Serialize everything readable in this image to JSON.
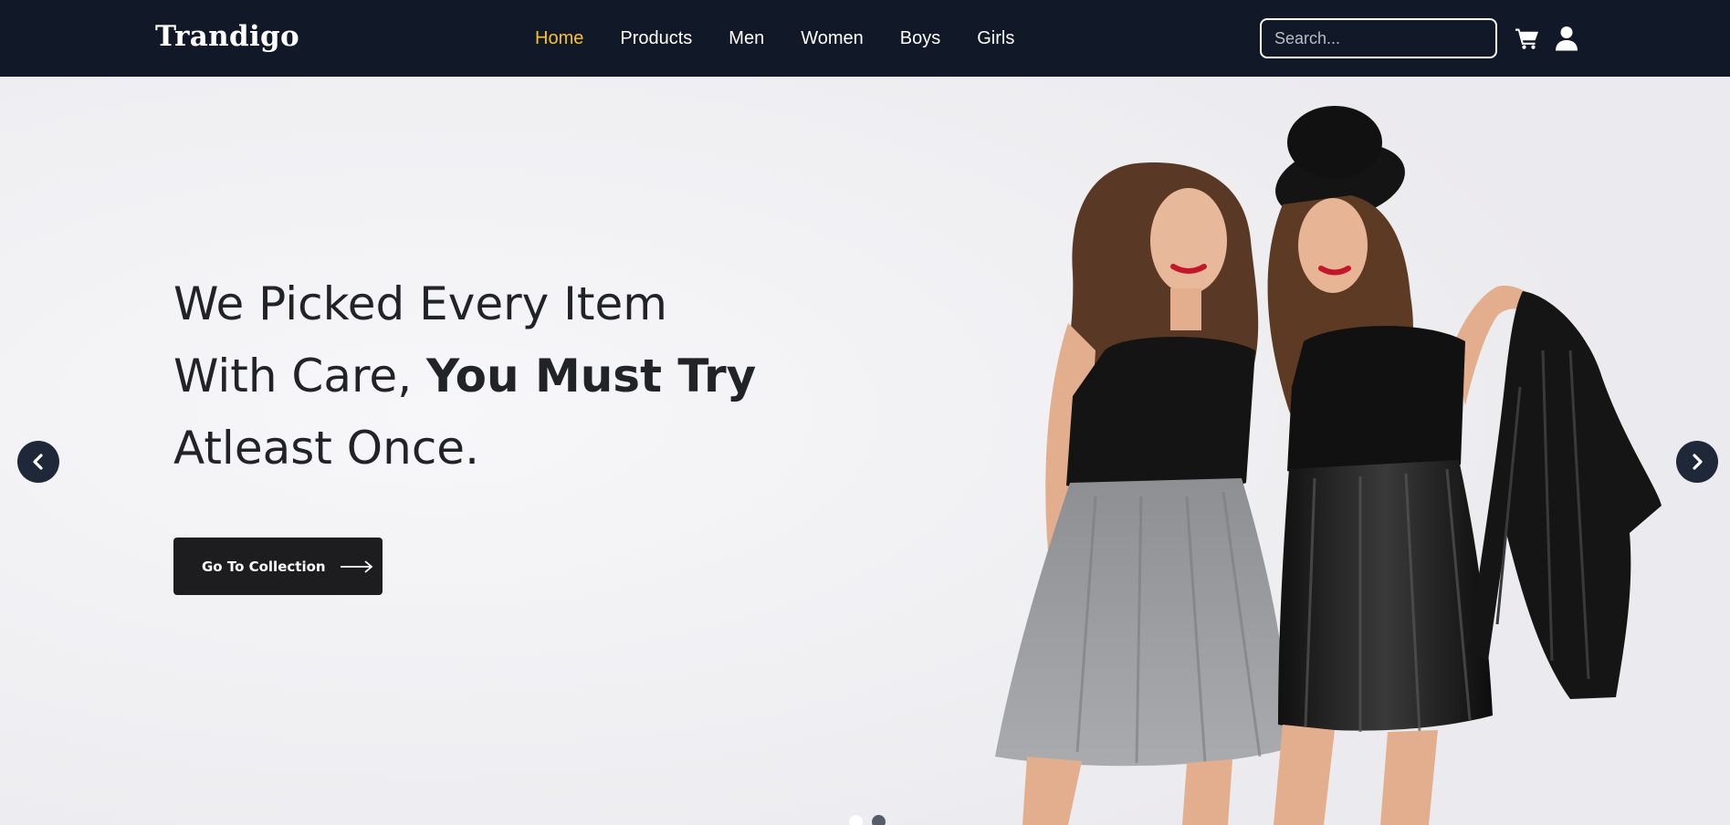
{
  "navbar": {
    "brand": "Trandigo",
    "links": [
      {
        "label": "Home",
        "active": true
      },
      {
        "label": "Products"
      },
      {
        "label": "Men"
      },
      {
        "label": "Women"
      },
      {
        "label": "Boys"
      },
      {
        "label": "Girls"
      }
    ],
    "search_placeholder": "Search...",
    "icons": [
      "cart-icon",
      "user-icon"
    ],
    "colors": {
      "background": "#111828",
      "active_link": "#f7c325",
      "link": "#ffffff"
    }
  },
  "hero": {
    "headline_line1": "We Picked Every Item",
    "headline_line2_regular": "With Care, ",
    "headline_line2_bold": "You Must Try",
    "headline_line3": "Atleast Once.",
    "cta_label": "Go To Collection",
    "cta_icon": "arrow-right-icon",
    "prev_icon": "chevron-left-icon",
    "next_icon": "chevron-right-icon",
    "slides_total": 2,
    "active_slide": 1,
    "colors": {
      "cta_background": "#1d1d1f",
      "carousel_button": "#1f2838"
    }
  }
}
